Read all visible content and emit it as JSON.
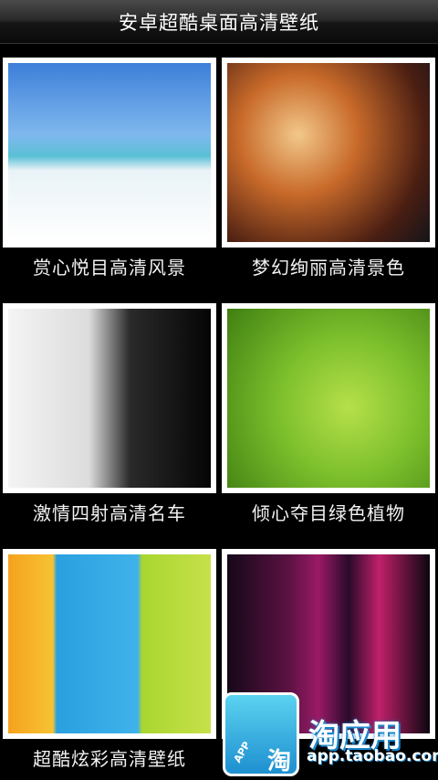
{
  "header": {
    "title": "安卓超酷桌面高清壁纸"
  },
  "categories": [
    {
      "label": "赏心悦目高清风景",
      "thumb": "beach-landscape-image"
    },
    {
      "label": "梦幻绚丽高清景色",
      "thumb": "fantasy-castle-image"
    },
    {
      "label": "激情四射高清名车",
      "thumb": "sports-car-image"
    },
    {
      "label": "倾心夺目绿色植物",
      "thumb": "green-leaf-ladybug-image"
    },
    {
      "label": "超酷炫彩高清壁纸",
      "thumb": "colorful-stripes-image"
    },
    {
      "label": "",
      "thumb": "dark-purple-light-image"
    }
  ],
  "watermark": {
    "bag_text": "APP",
    "bag_char": "淘",
    "brand": "淘应用",
    "url": "app.taobao.com"
  }
}
